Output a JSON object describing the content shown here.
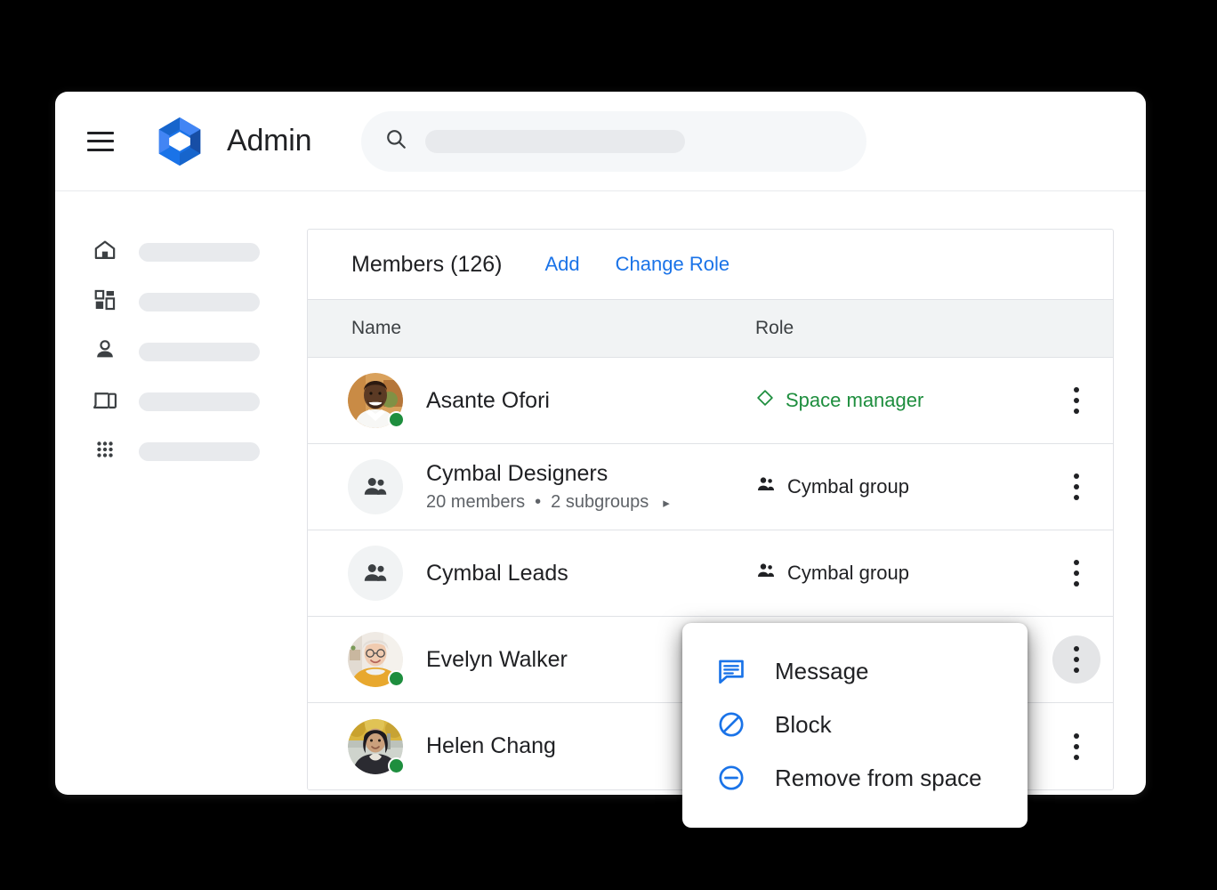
{
  "app": {
    "title": "Admin",
    "logo_colors": {
      "light": "#4285f4",
      "mid": "#1a73e8",
      "dark": "#1765cc",
      "deep": "#174ea6"
    }
  },
  "search": {
    "placeholder": ""
  },
  "sidebar": {
    "items": [
      {
        "icon": "home-icon"
      },
      {
        "icon": "dashboard-icon"
      },
      {
        "icon": "person-icon"
      },
      {
        "icon": "devices-icon"
      },
      {
        "icon": "apps-grid-icon"
      }
    ]
  },
  "members_panel": {
    "title": "Members (126)",
    "count": 126,
    "actions": [
      {
        "label": "Add",
        "name": "add-members-link"
      },
      {
        "label": "Change Role",
        "name": "change-role-link"
      }
    ],
    "columns": {
      "name": "Name",
      "role": "Role"
    },
    "rows": [
      {
        "name": "Asante Ofori",
        "subtitle": null,
        "avatar_type": "photo",
        "avatar_id": "asante",
        "presence": "online",
        "role_label": "Space manager",
        "role_icon": "diamond-icon",
        "role_style": "manager",
        "kebab_active": false
      },
      {
        "name": "Cymbal Designers",
        "subtitle": {
          "members": "20 members",
          "separator": "•",
          "subgroups": "2 subgroups",
          "chevron": "▸"
        },
        "avatar_type": "group",
        "avatar_id": "group",
        "presence": null,
        "role_label": "Cymbal group",
        "role_icon": "people-icon",
        "role_style": "group",
        "kebab_active": false
      },
      {
        "name": "Cymbal Leads",
        "subtitle": null,
        "avatar_type": "group",
        "avatar_id": "group",
        "presence": null,
        "role_label": "Cymbal group",
        "role_icon": "people-icon",
        "role_style": "group",
        "kebab_active": false
      },
      {
        "name": "Evelyn Walker",
        "subtitle": null,
        "avatar_type": "photo",
        "avatar_id": "evelyn",
        "presence": "online",
        "role_label": "",
        "role_icon": null,
        "role_style": "group",
        "kebab_active": true
      },
      {
        "name": "Helen Chang",
        "subtitle": null,
        "avatar_type": "photo",
        "avatar_id": "helen",
        "presence": "online",
        "role_label": "",
        "role_icon": null,
        "role_style": "group",
        "kebab_active": false
      }
    ]
  },
  "context_menu": {
    "items": [
      {
        "label": "Message",
        "icon": "message-icon"
      },
      {
        "label": "Block",
        "icon": "block-icon"
      },
      {
        "label": "Remove from space",
        "icon": "remove-circle-icon"
      }
    ]
  },
  "colors": {
    "link_blue": "#1a73e8",
    "manager_green": "#1e8e3e",
    "presence_green": "#1e8e3e",
    "text_primary": "#202124",
    "text_secondary": "#5f6368",
    "header_row_bg": "#f1f3f4",
    "placeholder_gray": "#e8eaed"
  }
}
